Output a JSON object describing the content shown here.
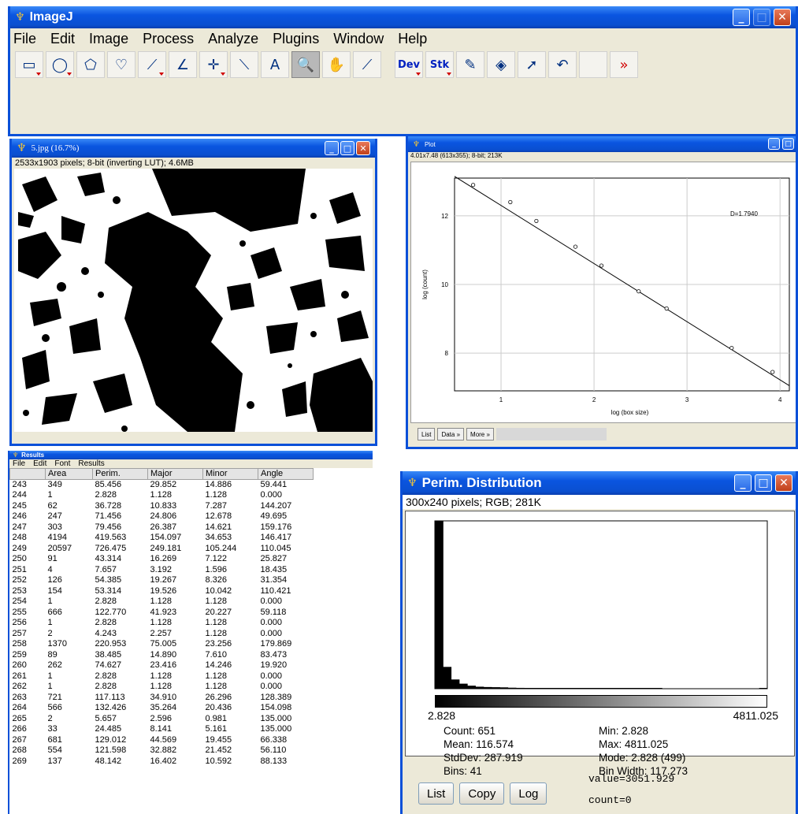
{
  "main_window": {
    "title": "ImageJ",
    "menu": [
      "File",
      "Edit",
      "Image",
      "Process",
      "Analyze",
      "Plugins",
      "Window",
      "Help"
    ],
    "tools": [
      {
        "name": "rectangle-tool-icon",
        "glyph": "▭",
        "arrow": true
      },
      {
        "name": "oval-tool-icon",
        "glyph": "◯",
        "arrow": true
      },
      {
        "name": "polygon-tool-icon",
        "glyph": "⬠",
        "arrow": false
      },
      {
        "name": "freehand-tool-icon",
        "glyph": "♡",
        "arrow": false
      },
      {
        "name": "line-tool-icon",
        "glyph": "⟋",
        "arrow": true
      },
      {
        "name": "angle-tool-icon",
        "glyph": "∠",
        "arrow": false
      },
      {
        "name": "point-tool-icon",
        "glyph": "✛",
        "arrow": true
      },
      {
        "name": "wand-tool-icon",
        "glyph": "⟍",
        "arrow": false
      },
      {
        "name": "text-tool-icon",
        "glyph": "A",
        "arrow": false
      },
      {
        "name": "magnifier-tool-icon",
        "glyph": "🔍",
        "arrow": false,
        "selected": true
      },
      {
        "name": "hand-tool-icon",
        "glyph": "✋",
        "arrow": false
      },
      {
        "name": "dropper-tool-icon",
        "glyph": "⟋",
        "arrow": false
      },
      {
        "name": "dev-tool",
        "glyph": "Dev",
        "arrow": true,
        "gap": true
      },
      {
        "name": "stk-tool",
        "glyph": "Stk",
        "arrow": true
      },
      {
        "name": "brush-tool-icon",
        "glyph": "✎",
        "arrow": false
      },
      {
        "name": "fill-tool-icon",
        "glyph": "◈",
        "arrow": false
      },
      {
        "name": "arrow-tool-icon",
        "glyph": "➚",
        "arrow": false
      },
      {
        "name": "curve-tool-icon",
        "glyph": "↶",
        "arrow": false
      },
      {
        "name": "blank-tool",
        "glyph": "",
        "arrow": false
      },
      {
        "name": "more-tools-icon",
        "glyph": "»",
        "arrow": false
      }
    ]
  },
  "image_window": {
    "title": "5.jpg (16.7%)",
    "info": "2533x1903 pixels; 8-bit (inverting LUT); 4.6MB"
  },
  "plot_window": {
    "title": "Plot",
    "info": "4.01x7.48 (613x355); 8-bit; 213K",
    "annotation": "D=1.7940",
    "xlabel": "log (box size)",
    "ylabel": "log (count)",
    "buttons": [
      "List",
      "Data »",
      "More »"
    ]
  },
  "chart_data": {
    "type": "scatter",
    "xlabel": "log (box size)",
    "ylabel": "log (count)",
    "xlim": [
      0.5,
      4.1
    ],
    "ylim": [
      6.9,
      13.1
    ],
    "x_ticks": [
      1,
      2,
      3,
      4
    ],
    "y_ticks": [
      8,
      10,
      12
    ],
    "annotation": "D=1.7940",
    "points": [
      [
        0.7,
        12.9
      ],
      [
        1.1,
        12.4
      ],
      [
        1.38,
        11.85
      ],
      [
        1.8,
        11.1
      ],
      [
        2.08,
        10.55
      ],
      [
        2.48,
        9.8
      ],
      [
        2.78,
        9.3
      ],
      [
        3.48,
        8.15
      ],
      [
        3.92,
        7.45
      ]
    ],
    "fit_line": [
      [
        0.5,
        13.15
      ],
      [
        4.1,
        7.05
      ]
    ]
  },
  "results_window": {
    "title": "Results",
    "menu": [
      "File",
      "Edit",
      "Font",
      "Results"
    ],
    "columns": [
      "",
      "Area",
      "Perim.",
      "Major",
      "Minor",
      "Angle"
    ],
    "rows": [
      [
        "243",
        "349",
        "85.456",
        "29.852",
        "14.886",
        "59.441"
      ],
      [
        "244",
        "1",
        "2.828",
        "1.128",
        "1.128",
        "0.000"
      ],
      [
        "245",
        "62",
        "36.728",
        "10.833",
        "7.287",
        "144.207"
      ],
      [
        "246",
        "247",
        "71.456",
        "24.806",
        "12.678",
        "49.695"
      ],
      [
        "247",
        "303",
        "79.456",
        "26.387",
        "14.621",
        "159.176"
      ],
      [
        "248",
        "4194",
        "419.563",
        "154.097",
        "34.653",
        "146.417"
      ],
      [
        "249",
        "20597",
        "726.475",
        "249.181",
        "105.244",
        "110.045"
      ],
      [
        "250",
        "91",
        "43.314",
        "16.269",
        "7.122",
        "25.827"
      ],
      [
        "251",
        "4",
        "7.657",
        "3.192",
        "1.596",
        "18.435"
      ],
      [
        "252",
        "126",
        "54.385",
        "19.267",
        "8.326",
        "31.354"
      ],
      [
        "253",
        "154",
        "53.314",
        "19.526",
        "10.042",
        "110.421"
      ],
      [
        "254",
        "1",
        "2.828",
        "1.128",
        "1.128",
        "0.000"
      ],
      [
        "255",
        "666",
        "122.770",
        "41.923",
        "20.227",
        "59.118"
      ],
      [
        "256",
        "1",
        "2.828",
        "1.128",
        "1.128",
        "0.000"
      ],
      [
        "257",
        "2",
        "4.243",
        "2.257",
        "1.128",
        "0.000"
      ],
      [
        "258",
        "1370",
        "220.953",
        "75.005",
        "23.256",
        "179.869"
      ],
      [
        "259",
        "89",
        "38.485",
        "14.890",
        "7.610",
        "83.473"
      ],
      [
        "260",
        "262",
        "74.627",
        "23.416",
        "14.246",
        "19.920"
      ],
      [
        "261",
        "1",
        "2.828",
        "1.128",
        "1.128",
        "0.000"
      ],
      [
        "262",
        "1",
        "2.828",
        "1.128",
        "1.128",
        "0.000"
      ],
      [
        "263",
        "721",
        "117.113",
        "34.910",
        "26.296",
        "128.389"
      ],
      [
        "264",
        "566",
        "132.426",
        "35.264",
        "20.436",
        "154.098"
      ],
      [
        "265",
        "2",
        "5.657",
        "2.596",
        "0.981",
        "135.000"
      ],
      [
        "266",
        "33",
        "24.485",
        "8.141",
        "5.161",
        "135.000"
      ],
      [
        "267",
        "681",
        "129.012",
        "44.569",
        "19.455",
        "66.338"
      ],
      [
        "268",
        "554",
        "121.598",
        "32.882",
        "21.452",
        "56.110"
      ],
      [
        "269",
        "137",
        "48.142",
        "16.402",
        "10.592",
        "88.133"
      ]
    ]
  },
  "perim_window": {
    "title": "Perim. Distribution",
    "info": "300x240 pixels; RGB; 281K",
    "min_label": "2.828",
    "max_label": "4811.025",
    "stats_left": [
      "Count: 651",
      "Mean: 116.574",
      "StdDev: 287.919",
      "Bins: 41"
    ],
    "stats_right": [
      "Min: 2.828",
      "Max: 4811.025",
      "Mode: 2.828 (499)",
      "Bin Width: 117.273"
    ],
    "buttons": [
      "List",
      "Copy",
      "Log"
    ],
    "value": "value=3051.929",
    "count": "count=0",
    "hist_fractions": [
      1,
      0.13,
      0.055,
      0.03,
      0.018,
      0.012,
      0.01,
      0.009,
      0.008,
      0.006,
      0.005,
      0.004,
      0.004,
      0.003,
      0.003,
      0.002,
      0.002,
      0.002,
      0.002,
      0.002,
      0.001,
      0.001,
      0.001,
      0.001,
      0.001,
      0.001,
      0.001,
      0.001,
      0,
      0,
      0,
      0,
      0,
      0,
      0,
      0,
      0,
      0,
      0,
      0,
      0.001
    ]
  }
}
